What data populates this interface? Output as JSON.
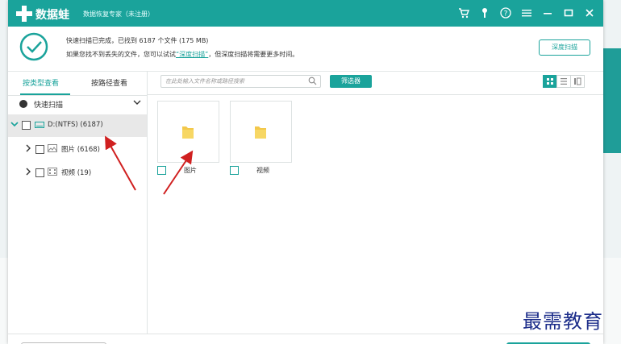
{
  "titlebar": {
    "brand": "数据蛙",
    "subtitle": "数据恢复专家（未注册）",
    "icons": [
      "cart-icon",
      "key-icon",
      "help-icon",
      "menu-icon",
      "minimize-icon",
      "maximize-icon",
      "close-icon"
    ]
  },
  "status": {
    "line1": "快速扫描已完成，已找到 6187 个文件 (175 MB)",
    "line2_pre": "如果您找不到丢失的文件，您可以试试",
    "line2_link": "“深度扫描”",
    "line2_post": "，但深度扫描将需要更多时间。",
    "deep_scan_button": "深度扫描"
  },
  "tabs": {
    "by_type": "按类型查看",
    "by_path": "按路径查看"
  },
  "tree": {
    "quick_scan": "快速扫描",
    "drive": "D:(NTFS) (6187)",
    "items": [
      {
        "label": "图片 (6168)"
      },
      {
        "label": "视频 (19)"
      }
    ]
  },
  "toolbar": {
    "search_placeholder": "在此处输入文件名称或路径搜索",
    "filter_button": "筛选器"
  },
  "tiles": [
    {
      "label": "图片"
    },
    {
      "label": "视频"
    }
  ],
  "colors": {
    "accent": "#1aa39b",
    "watermark": "#1c2d8a",
    "arrow": "#d02020"
  },
  "watermark": "最需教育"
}
